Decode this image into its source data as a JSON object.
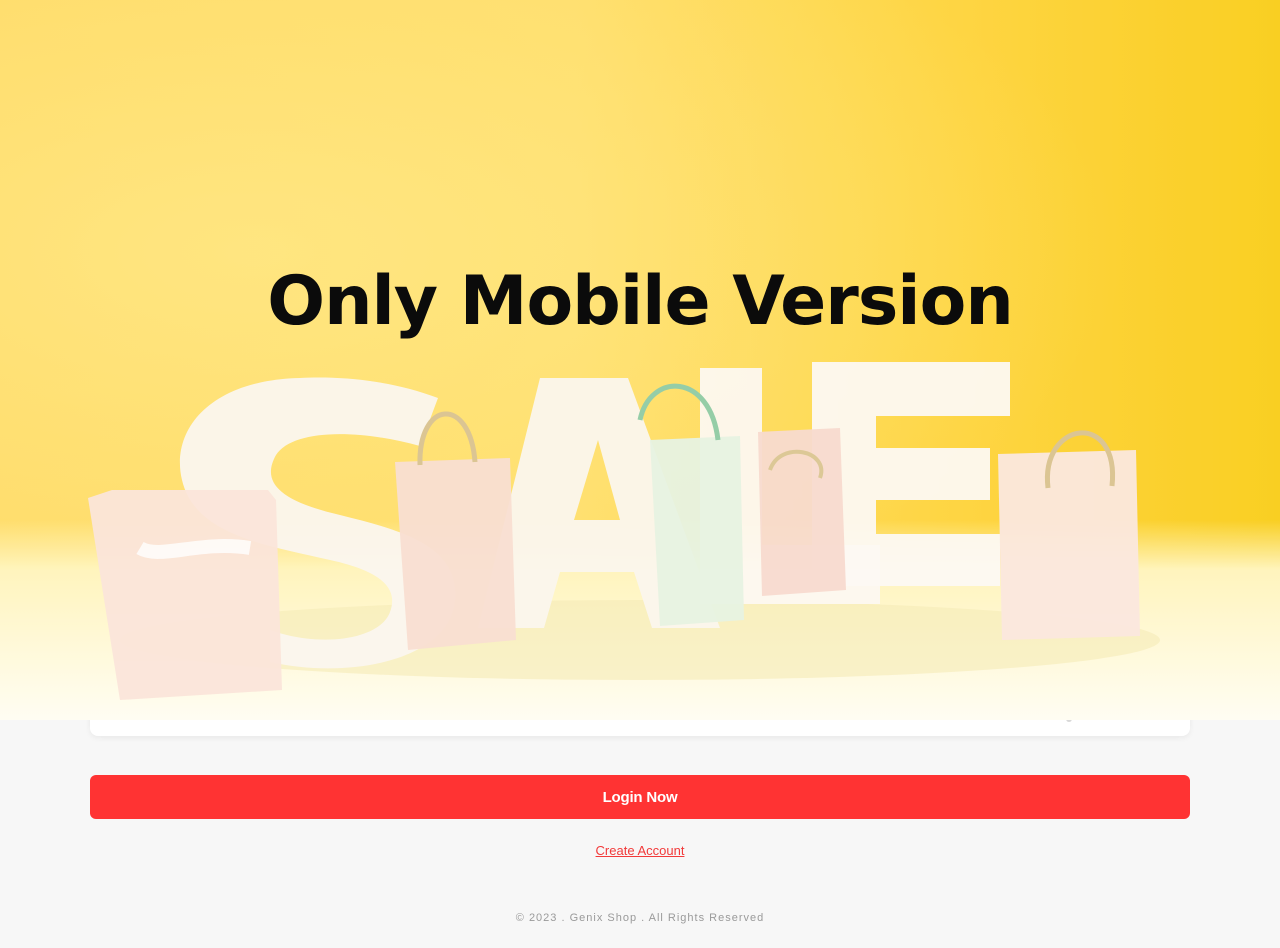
{
  "overlay": {
    "headline": "Only Mobile Version",
    "image_text": "SALE"
  },
  "login": {
    "button_label": "Login Now",
    "create_account_label": "Create Account"
  },
  "footer": {
    "copyright": "© 2023 . Genix Shop . All Rights Reserved"
  },
  "colors": {
    "accent": "#ff3333",
    "link": "#f23a3a",
    "banner_yellow": "#ffd95a",
    "background": "#f7f7f7"
  }
}
